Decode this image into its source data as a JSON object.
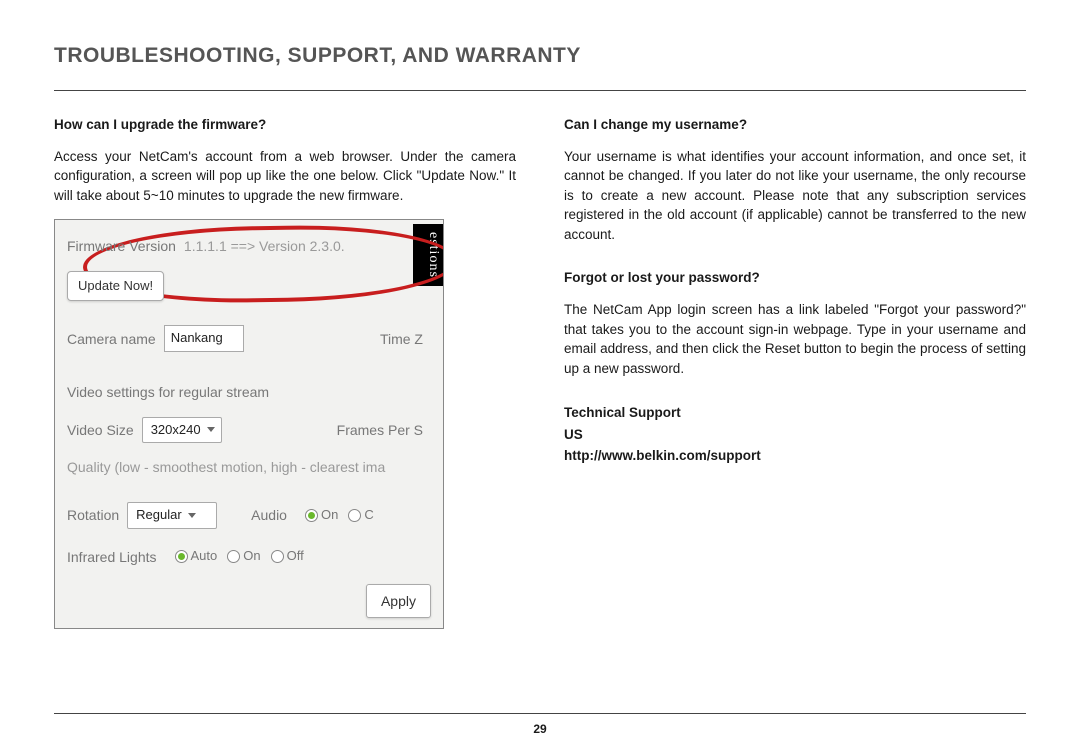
{
  "page_title": "TROUBLESHOOTING, SUPPORT, AND WARRANTY",
  "page_number": "29",
  "left": {
    "q1": "How can I upgrade the firmware?",
    "a1": "Access your NetCam's account from a web browser. Under the camera configuration, a screen will pop up like the one below. Click \"Update Now.\" It will take about 5~10 minutes to upgrade the new firmware."
  },
  "right": {
    "q2": "Can I change my username?",
    "a2": "Your username is what identifies your account information, and once set, it cannot be changed. If you later do not like your username, the only recourse is to create a new account. Please note that any subscription services registered in the old account (if applicable) cannot be transferred to the new account.",
    "q3": "Forgot or lost your password?",
    "a3": "The NetCam App login screen has a link labeled \"Forgot your password?\" that takes you to the account sign-in webpage. Type in your username and email address, and then click the Reset button to begin the process of setting up a new password.",
    "tech_heading": "Technical Support",
    "tech_region": "US",
    "tech_url": "http://www.belkin.com/support"
  },
  "screenshot": {
    "side_tab": "estions",
    "fw_label": "Firmware Version",
    "fw_text": "1.1.1.1  ==>  Version  2.3.0.",
    "update_btn": "Update Now!",
    "cam_label": "Camera name",
    "cam_value": "Nankang",
    "timez": "Time Z",
    "vid_header": "Video settings for regular stream",
    "vsize_label": "Video Size",
    "vsize_value": "320x240",
    "fps": "Frames Per S",
    "quality": "Quality (low - smoothest motion, high - clearest ima",
    "rot_label": "Rotation",
    "rot_value": "Regular",
    "audio": "Audio",
    "on": "On",
    "c": "C",
    "ir_label": "Infrared Lights",
    "auto": "Auto",
    "off": "Off",
    "apply": "Apply"
  }
}
